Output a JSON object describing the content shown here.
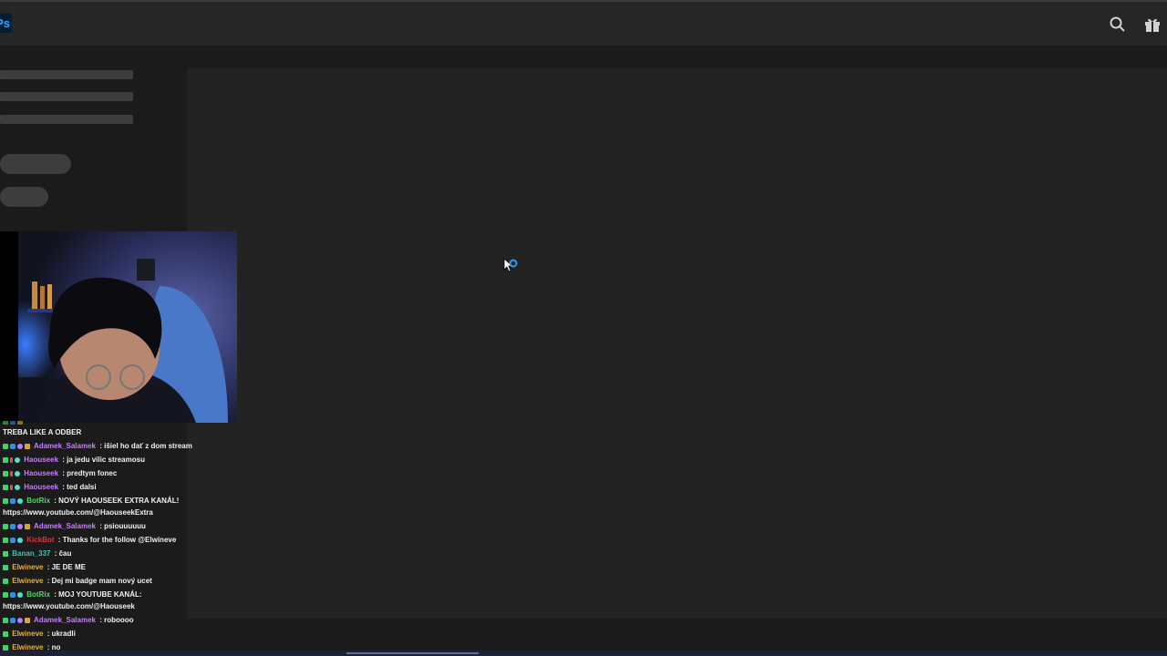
{
  "app": {
    "logo_text": "Ps"
  },
  "chat": {
    "lines": [
      {
        "user": "",
        "text": "TREBA LIKE A ODBER",
        "color": "#ffffff"
      },
      {
        "user": "Adamek_Salamek",
        "text": " : išiel ho dať z dom stream",
        "color": "#c77dff"
      },
      {
        "user": "Haouseek",
        "text": " : ja jedu vilic streamosu",
        "color": "#c77dff"
      },
      {
        "user": "Haouseek",
        "text": " : predtym fonec",
        "color": "#c77dff"
      },
      {
        "user": "Haouseek",
        "text": " : ted dalsi",
        "color": "#c77dff"
      },
      {
        "user": "BotRix",
        "text": " : NOVÝ HAOUSEEK EXTRA KANÁL!",
        "color": "#4cd964"
      },
      {
        "user": "",
        "text": "https://www.youtube.com/@HaouseekExtra",
        "color": "#ffffff"
      },
      {
        "user": "Adamek_Salamek",
        "text": " : psiouuuuuu",
        "color": "#c77dff"
      },
      {
        "user": "KickBot",
        "text": " : Thanks for the follow @Elwineve",
        "color": "#d9363e"
      },
      {
        "user": "Banan_337",
        "text": " : čau",
        "color": "#3fc7b0"
      },
      {
        "user": "Elwineve",
        "text": " : JE DE ME",
        "color": "#e8b03a"
      },
      {
        "user": "Elwineve",
        "text": " : Dej mi badge mam nový ucet",
        "color": "#e8b03a"
      },
      {
        "user": "BotRix",
        "text": " : MOJ YOUTUBE KANÁL:",
        "color": "#4cd964"
      },
      {
        "user": "",
        "text": "https://www.youtube.com/@Haouseek",
        "color": "#ffffff"
      },
      {
        "user": "Adamek_Salamek",
        "text": " : roboooo",
        "color": "#c77dff"
      },
      {
        "user": "Elwineve",
        "text": " : ukradli",
        "color": "#e8b03a"
      },
      {
        "user": "Elwineve",
        "text": " : no",
        "color": "#e8b03a"
      }
    ]
  }
}
